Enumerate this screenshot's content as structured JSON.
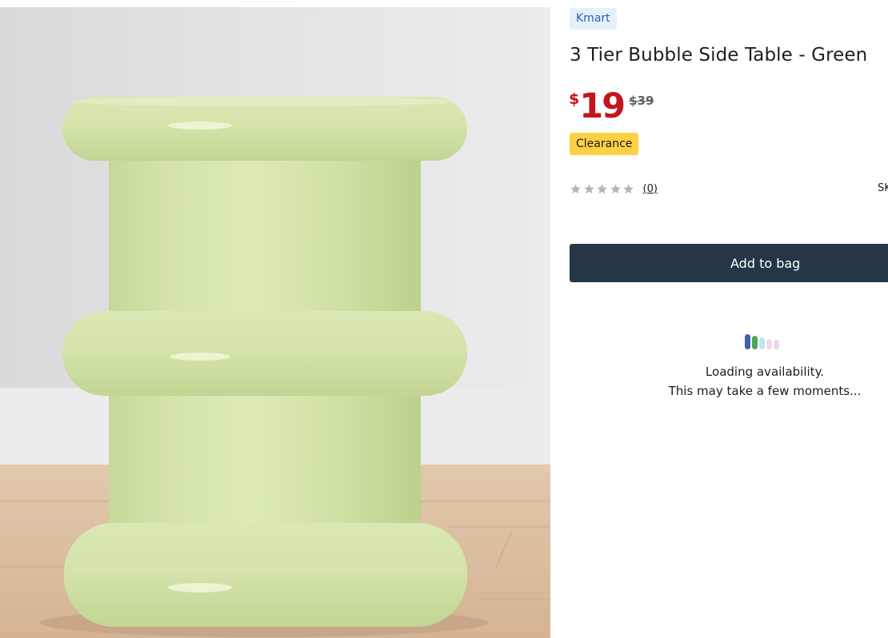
{
  "product": {
    "brand": "Kmart",
    "title": "3 Tier Bubble Side Table - Green",
    "image_subject": "green three-tier bubble side table"
  },
  "price": {
    "currency_symbol": "$",
    "current": "19",
    "was": "$39",
    "color": "#c4161c"
  },
  "badges": {
    "clearance": "Clearance",
    "clearance_color": "#fdd046"
  },
  "rating": {
    "stars": 0,
    "max_stars": 5,
    "review_count": "(0)"
  },
  "sku": {
    "label": "SK"
  },
  "actions": {
    "add_to_bag": "Add to bag",
    "button_color": "#253746"
  },
  "availability": {
    "line1": "Loading availability.",
    "line2": "This may take a few moments..."
  }
}
